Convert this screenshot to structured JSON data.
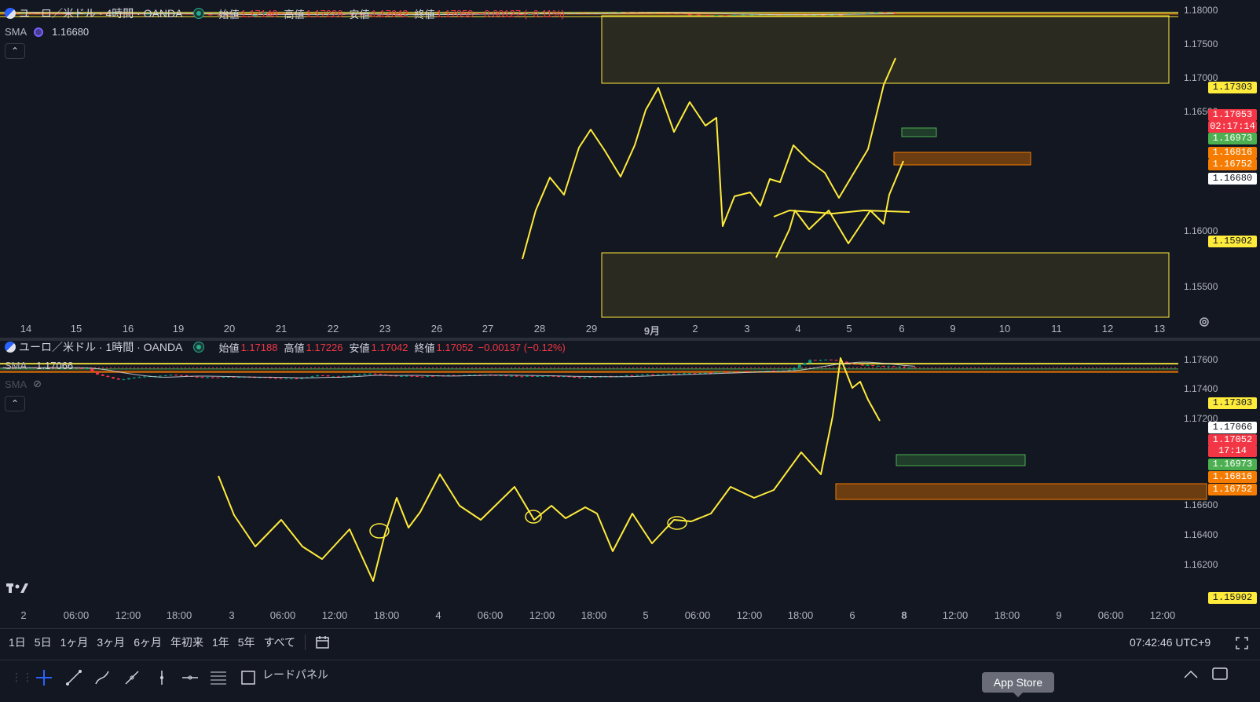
{
  "top_chart": {
    "symbol": "ユーロ／米ドル · 4時間 · OANDA",
    "ohlc": [
      {
        "label": "始値",
        "value": "1.17140"
      },
      {
        "label": "高値",
        "value": "1.17226"
      },
      {
        "label": "安値",
        "value": "1.17042"
      },
      {
        "label": "終値",
        "value": "1.17053"
      }
    ],
    "change": "−0.00127 (−0.11%)",
    "sma_label": "SMA",
    "sma_value": "1.16680",
    "price_axis": [
      "1.18000",
      "1.17500",
      "1.17000",
      "1.16500",
      "1.16000",
      "1.15500"
    ],
    "price_labels": [
      {
        "text": "1.17303",
        "kind": "yellow",
        "price": 1.17303
      },
      {
        "text": "1.17053",
        "kind": "red",
        "price": 1.17053
      },
      {
        "text": "02:17:14",
        "kind": "red-sub",
        "price": 1.17053
      },
      {
        "text": "1.16973",
        "kind": "green",
        "price": 1.16973
      },
      {
        "text": "1.16816",
        "kind": "orange",
        "price": 1.16816
      },
      {
        "text": "1.16752",
        "kind": "orange",
        "price": 1.16752
      },
      {
        "text": "1.16680",
        "kind": "white",
        "price": 1.1668
      },
      {
        "text": "1.15902",
        "kind": "yellow",
        "price": 1.15902
      }
    ],
    "time_axis": [
      "14",
      "15",
      "16",
      "19",
      "20",
      "21",
      "22",
      "23",
      "26",
      "27",
      "28",
      "29",
      "9月",
      "2",
      "3",
      "4",
      "5",
      "6",
      "9",
      "10",
      "11",
      "12",
      "13"
    ]
  },
  "bottom_chart": {
    "symbol": "ユーロ／米ドル · 1時間 · OANDA",
    "ohlc": [
      {
        "label": "始値",
        "value": "1.17188"
      },
      {
        "label": "高値",
        "value": "1.17226"
      },
      {
        "label": "安値",
        "value": "1.17042"
      },
      {
        "label": "終値",
        "value": "1.17052"
      }
    ],
    "change": "−0.00137 (−0.12%)",
    "sma_label": "SMA",
    "sma_value": "1.17066",
    "sma2_label": "SMA",
    "price_axis": [
      "1.17600",
      "1.17400",
      "1.17200",
      "1.16600",
      "1.16400",
      "1.16200"
    ],
    "price_labels": [
      {
        "text": "1.17303",
        "kind": "yellow",
        "price": 1.17303
      },
      {
        "text": "1.17066",
        "kind": "white",
        "price": 1.17066
      },
      {
        "text": "1.17052",
        "kind": "red",
        "price": 1.17052
      },
      {
        "text": "17:14",
        "kind": "red-sub",
        "price": 1.17052
      },
      {
        "text": "1.16973",
        "kind": "green",
        "price": 1.16973
      },
      {
        "text": "1.16816",
        "kind": "orange",
        "price": 1.16816
      },
      {
        "text": "1.16752",
        "kind": "orange",
        "price": 1.16752
      },
      {
        "text": "1.15902",
        "kind": "yellow",
        "price": 1.15902
      }
    ],
    "time_axis": [
      "2",
      "06:00",
      "12:00",
      "18:00",
      "3",
      "06:00",
      "12:00",
      "18:00",
      "4",
      "06:00",
      "12:00",
      "18:00",
      "5",
      "06:00",
      "12:00",
      "18:00",
      "6",
      "8",
      "12:00",
      "18:00",
      "9",
      "06:00",
      "12:00"
    ]
  },
  "ranges": [
    "1日",
    "5日",
    "1ヶ月",
    "3ヶ月",
    "6ヶ月",
    "年初来",
    "1年",
    "5年",
    "すべて"
  ],
  "clock": "07:42:46 UTC+9",
  "toolbar_label": "レードパネル",
  "tooltip": "App Store",
  "colors": {
    "bg": "#131722",
    "up": "#089981",
    "down": "#f23645",
    "yellow": "#ffeb3b",
    "orange": "#f57c00",
    "green_line": "#4caf50",
    "sma": "#e0e3eb"
  }
}
